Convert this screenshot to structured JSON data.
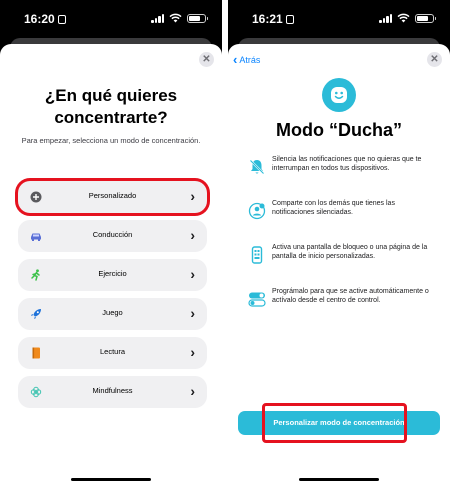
{
  "left": {
    "status": {
      "time": "16:20"
    },
    "title": "¿En qué quieres concentrarte?",
    "subtitle": "Para empezar, selecciona un modo de concentración.",
    "modes": [
      {
        "label": "Personalizado",
        "icon": "custom-plus-icon",
        "highlighted": true
      },
      {
        "label": "Conducción",
        "icon": "car-icon"
      },
      {
        "label": "Ejercicio",
        "icon": "running-icon"
      },
      {
        "label": "Juego",
        "icon": "rocket-icon"
      },
      {
        "label": "Lectura",
        "icon": "book-icon"
      },
      {
        "label": "Mindfulness",
        "icon": "flower-icon"
      }
    ]
  },
  "right": {
    "status": {
      "time": "16:21"
    },
    "back_label": "Atrás",
    "title": "Modo “Ducha”",
    "features": [
      {
        "text": "Silencia las notificaciones que no quieras que te interrumpan en todos tus dispositivos.",
        "icon": "bell-slash-icon"
      },
      {
        "text": "Comparte con los demás que tienes las notificaciones silenciadas.",
        "icon": "person-share-icon"
      },
      {
        "text": "Activa una pantalla de bloqueo o una página de la pantalla de inicio personalizadas.",
        "icon": "phone-screen-icon"
      },
      {
        "text": "Prográmalo para que se active automáticamente o actívalo desde el centro de control.",
        "icon": "toggle-icon"
      }
    ],
    "cta_label": "Personalizar modo de concentración"
  },
  "colors": {
    "accent": "#2bbbd8",
    "link": "#0a84ff",
    "highlight": "#e5121f"
  }
}
